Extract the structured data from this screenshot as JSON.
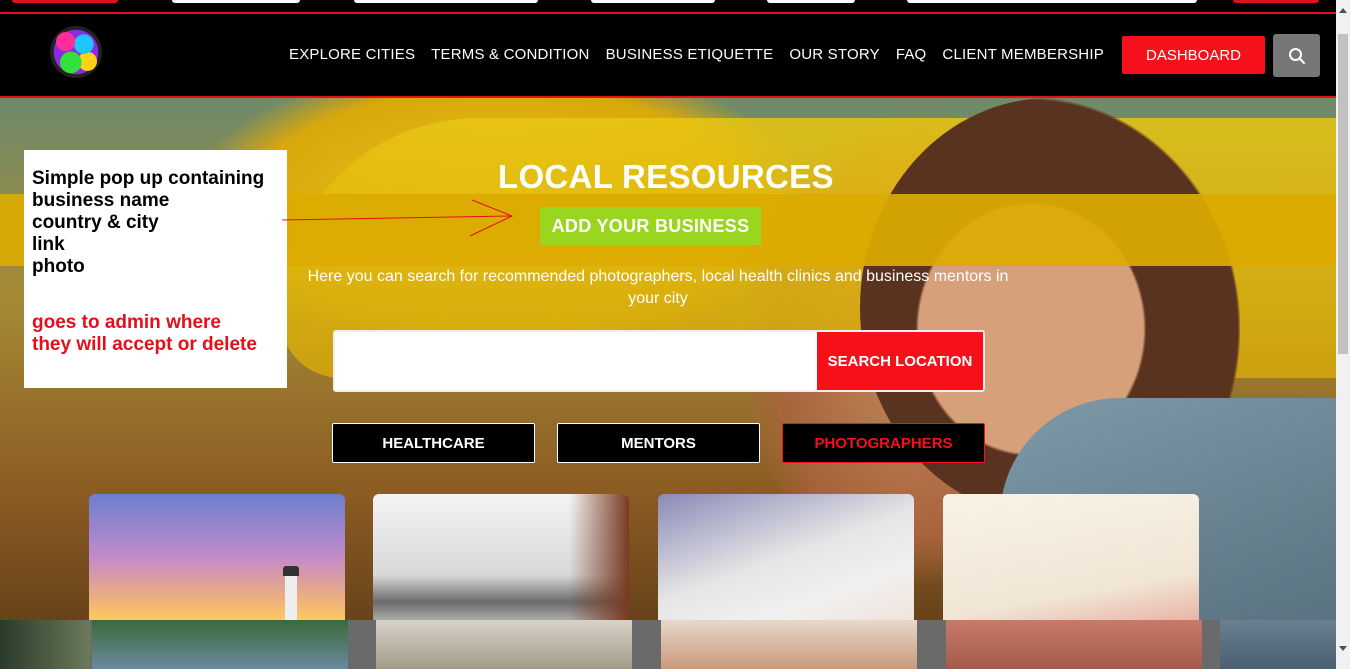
{
  "nav": {
    "items": [
      "EXPLORE CITIES",
      "TERMS & CONDITION",
      "BUSINESS ETIQUETTE",
      "OUR STORY",
      "FAQ",
      "CLIENT MEMBERSHIP"
    ],
    "dashboard": "DASHBOARD",
    "search_icon": "search-icon"
  },
  "hero": {
    "title": "LOCAL RESOURCES",
    "add_business": "ADD YOUR BUSINESS",
    "subtitle": "Here you can search for recommended photographers, local health clinics and business mentors in your city",
    "search_placeholder": "",
    "search_button": "SEARCH LOCATION",
    "categories": [
      {
        "label": "HEALTHCARE",
        "active": false
      },
      {
        "label": "MENTORS",
        "active": false
      },
      {
        "label": "PHOTOGRAPHERS",
        "active": true
      }
    ]
  },
  "annotation": {
    "lines": [
      "Simple pop up containing",
      "business name",
      "country & city",
      "link",
      "photo"
    ],
    "note_lines": [
      "goes to admin where",
      "they will accept or delete"
    ]
  },
  "colors": {
    "accent": "#f5101a",
    "add_business_bg": "#9ad61f",
    "band": "#dcaa00",
    "header_bg": "#000000"
  }
}
